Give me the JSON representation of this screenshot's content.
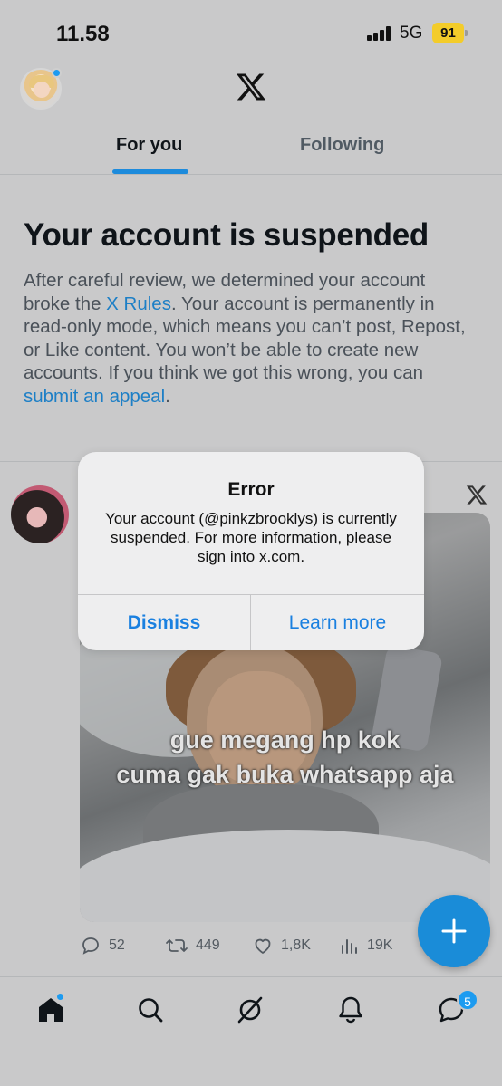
{
  "status_bar": {
    "time": "11.58",
    "network": "5G",
    "battery": "91"
  },
  "header": {
    "logo_icon": "x-logo-icon",
    "tabs": [
      {
        "label": "For you",
        "active": true
      },
      {
        "label": "Following",
        "active": false
      }
    ]
  },
  "notice": {
    "title": "Your account is suspended",
    "body_1": "After careful review, we determined your account broke the ",
    "link_rules": "X Rules",
    "body_2": ". Your account is permanently in read-only mode, which means you can’t post, Repost, or Like content. You won’t be able to create new accounts. If you think we got this wrong, you can ",
    "link_appeal": "submit an appeal",
    "body_3": "."
  },
  "post": {
    "caption_line_1": "gue megang hp kok",
    "caption_line_2": "cuma gak buka whatsapp aja",
    "replies": "52",
    "reposts": "449",
    "likes": "1,8K",
    "views": "19K"
  },
  "alert": {
    "title": "Error",
    "message": "Your account (@pinkzbrooklys) is currently suspended. For more information, please sign into x.com.",
    "dismiss_label": "Dismiss",
    "learn_more_label": "Learn more"
  },
  "bottom_nav": {
    "items": [
      "home-icon",
      "search-icon",
      "grok-icon",
      "notifications-icon",
      "messages-icon"
    ],
    "messages_badge": "5"
  },
  "colors": {
    "accent": "#1d9bf0",
    "link": "#1d7fc6",
    "battery": "#f3cc2a"
  }
}
